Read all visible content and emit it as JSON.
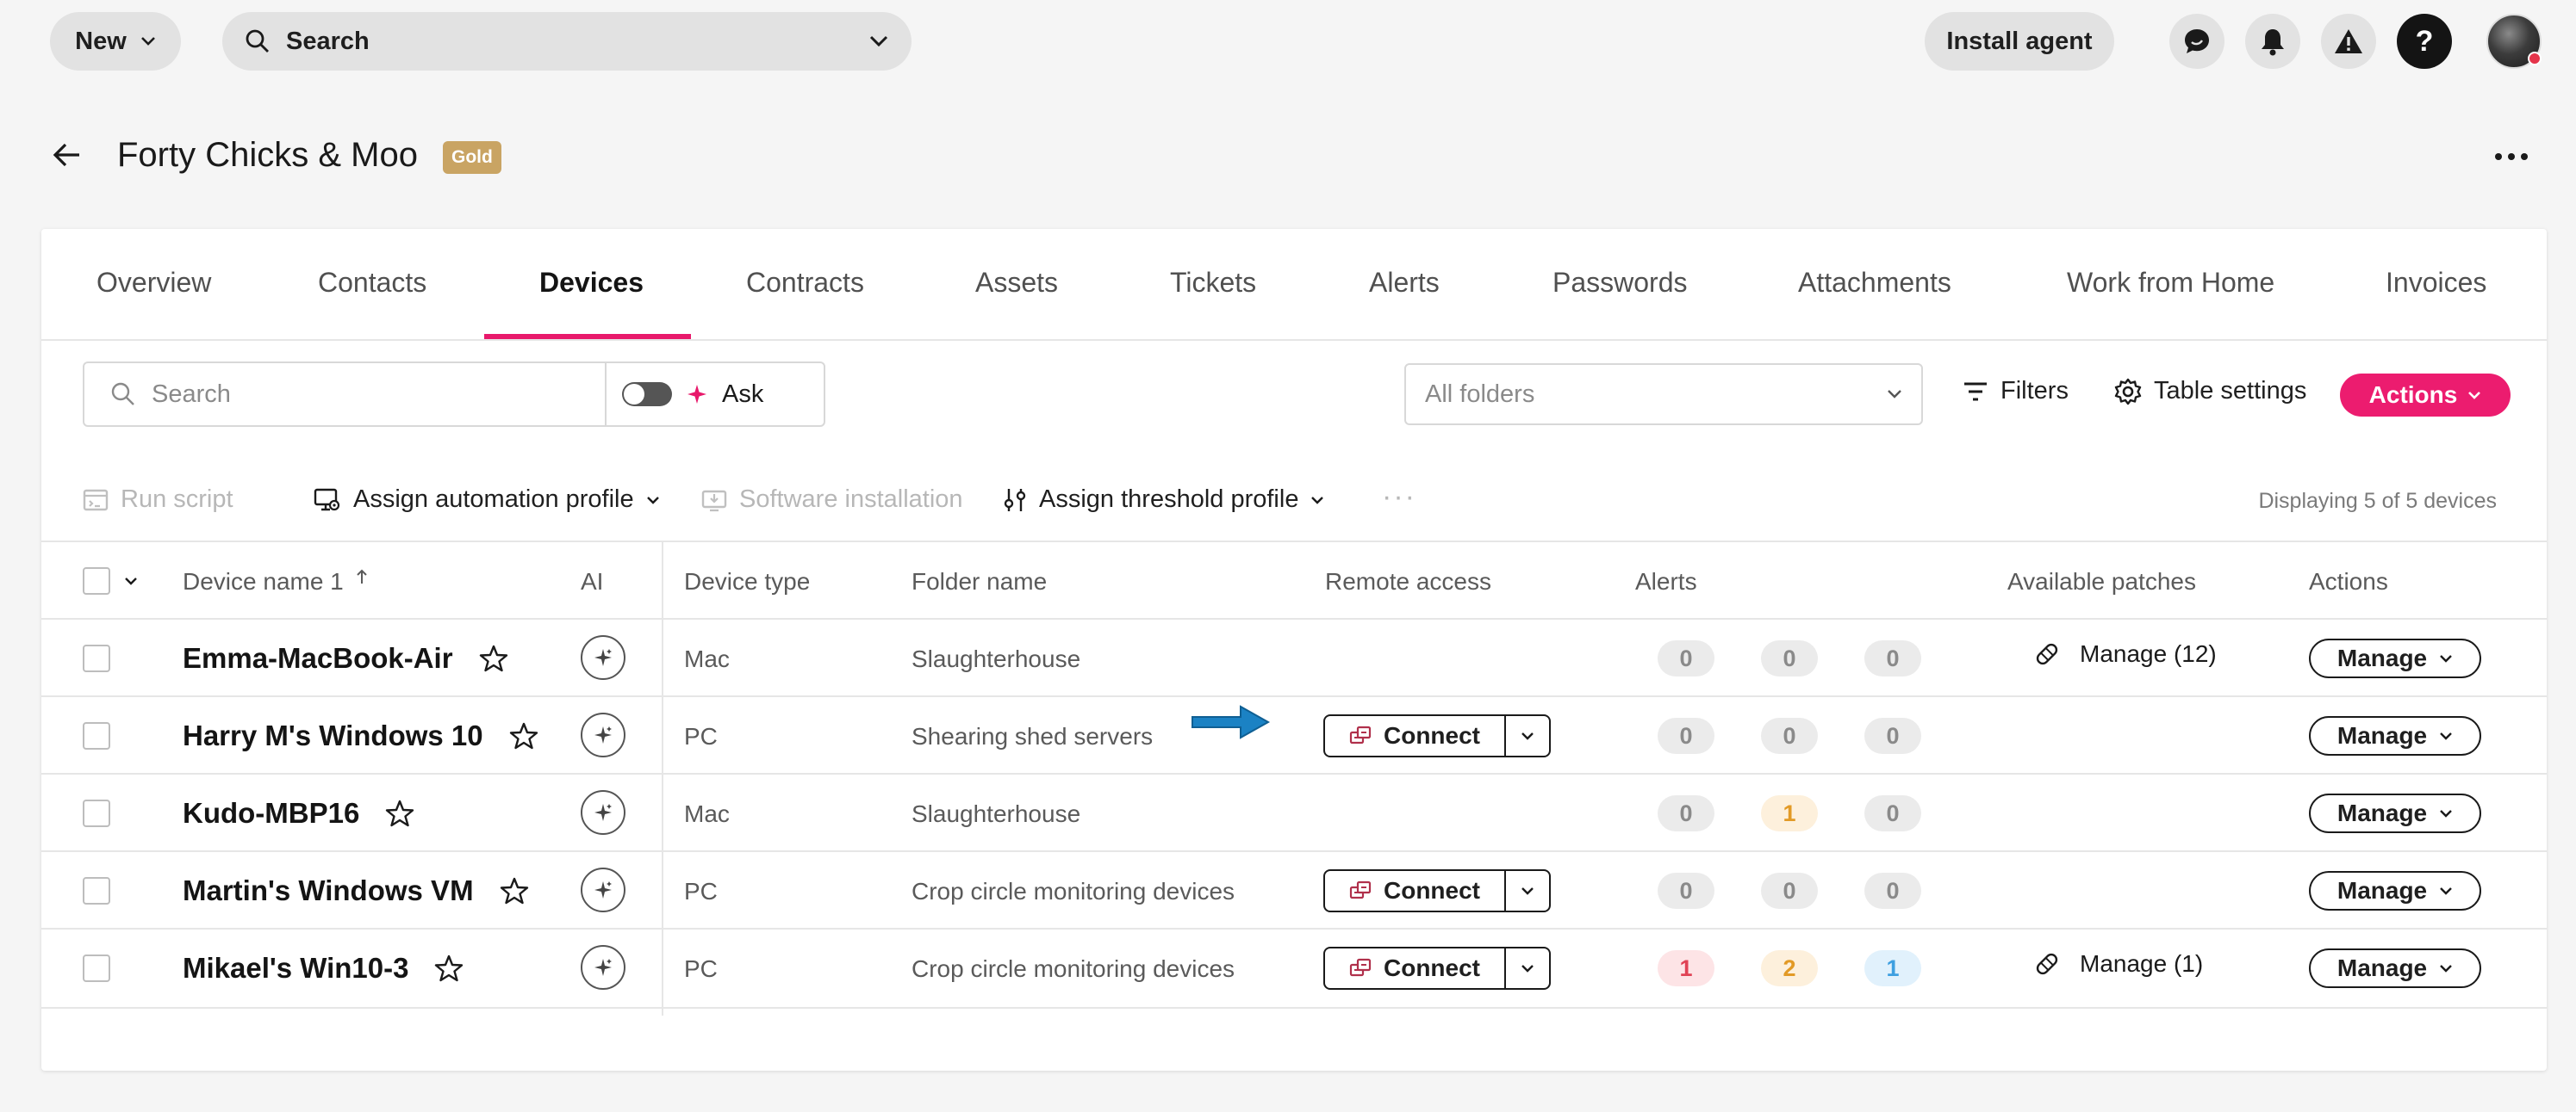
{
  "topbar": {
    "new_label": "New",
    "search_label": "Search",
    "install_label": "Install agent",
    "help_label": "?"
  },
  "header": {
    "title": "Forty Chicks & Moo",
    "badge": "Gold"
  },
  "tabs": [
    "Overview",
    "Contacts",
    "Devices",
    "Contracts",
    "Assets",
    "Tickets",
    "Alerts",
    "Passwords",
    "Attachments",
    "Work from Home",
    "Invoices"
  ],
  "active_tab": "Devices",
  "filters": {
    "search_placeholder": "Search",
    "ask_label": "Ask",
    "folders_placeholder": "All folders",
    "filters_label": "Filters",
    "table_settings_label": "Table settings",
    "actions_label": "Actions"
  },
  "toolbar": {
    "run_script": "Run script",
    "assign_automation": "Assign automation profile",
    "software_installation": "Software installation",
    "assign_threshold": "Assign threshold profile",
    "more": "···",
    "displaying": "Displaying 5 of 5 devices"
  },
  "columns": {
    "device_name": "Device name 1",
    "ai": "AI",
    "device_type": "Device type",
    "folder_name": "Folder name",
    "remote_access": "Remote access",
    "alerts": "Alerts",
    "available_patches": "Available patches",
    "actions": "Actions"
  },
  "connect_label": "Connect",
  "manage_label": "Manage",
  "rows": [
    {
      "name": "Emma-MacBook-Air",
      "type": "Mac",
      "folder": "Slaughterhouse",
      "connect": false,
      "alerts": [
        0,
        0,
        0
      ],
      "patches": "Manage (12)"
    },
    {
      "name": "Harry M's Windows 10",
      "type": "PC",
      "folder": "Shearing shed servers",
      "connect": true,
      "alerts": [
        0,
        0,
        0
      ],
      "patches": ""
    },
    {
      "name": "Kudo-MBP16",
      "type": "Mac",
      "folder": "Slaughterhouse",
      "connect": false,
      "alerts": [
        0,
        1,
        0
      ],
      "patches": ""
    },
    {
      "name": "Martin's Windows VM",
      "type": "PC",
      "folder": "Crop circle monitoring devices",
      "connect": true,
      "alerts": [
        0,
        0,
        0
      ],
      "patches": ""
    },
    {
      "name": "Mikael's Win10-3",
      "type": "PC",
      "folder": "Crop circle monitoring devices",
      "connect": true,
      "alerts": [
        1,
        2,
        1
      ],
      "patches": "Manage (1)"
    }
  ],
  "colors": {
    "accent": "#ec1c6f",
    "gold": "#c9a463",
    "arrow": "#1b82c4"
  }
}
